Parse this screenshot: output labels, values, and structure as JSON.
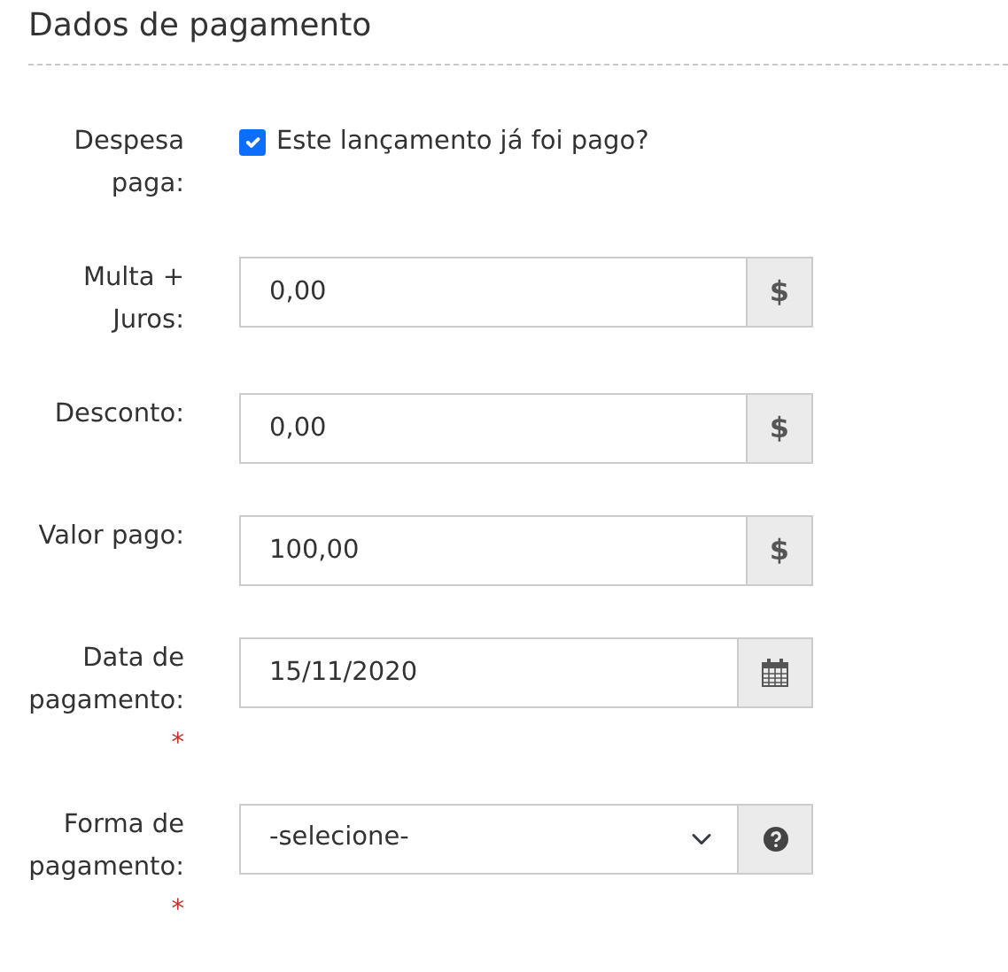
{
  "title": "Dados de pagamento",
  "fields": [
    {
      "kind": "checkbox",
      "label": "Despesa paga:",
      "checked": true,
      "text": "Este lançamento já foi pago?"
    },
    {
      "kind": "money",
      "label": "Multa + Juros:",
      "value": "0,00",
      "addon": "$"
    },
    {
      "kind": "money",
      "label": "Desconto:",
      "value": "0,00",
      "addon": "$"
    },
    {
      "kind": "money",
      "label": "Valor pago:",
      "value": "100,00",
      "addon": "$"
    },
    {
      "kind": "date",
      "label": "Data de pagamento:",
      "required_mark": "*",
      "value": "15/11/2020"
    },
    {
      "kind": "select",
      "label": "Forma de pagamento:",
      "required_mark": "*",
      "value": "-selecione-"
    }
  ]
}
